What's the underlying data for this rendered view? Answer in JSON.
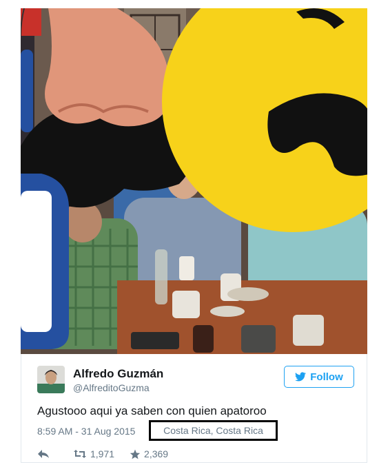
{
  "user": {
    "display_name": "Alfredo Guzmán",
    "handle": "@AlfreditoGuzma"
  },
  "follow_button": {
    "label": "Follow"
  },
  "tweet": {
    "text": "Agustooo aqui ya saben con quien apatoroo",
    "timestamp": "8:59 AM - 31 Aug 2015",
    "location": "Costa Rica, Costa Rica"
  },
  "actions": {
    "retweet_count": "1,971",
    "like_count": "2,369"
  },
  "icons": {
    "reply": "reply-icon",
    "retweet": "retweet-icon",
    "like": "star-icon",
    "follow": "bird-icon"
  },
  "colors": {
    "twitter_blue": "#1da1f2",
    "emoji_yellow": "#f7d21a",
    "muted_text": "#657786"
  }
}
